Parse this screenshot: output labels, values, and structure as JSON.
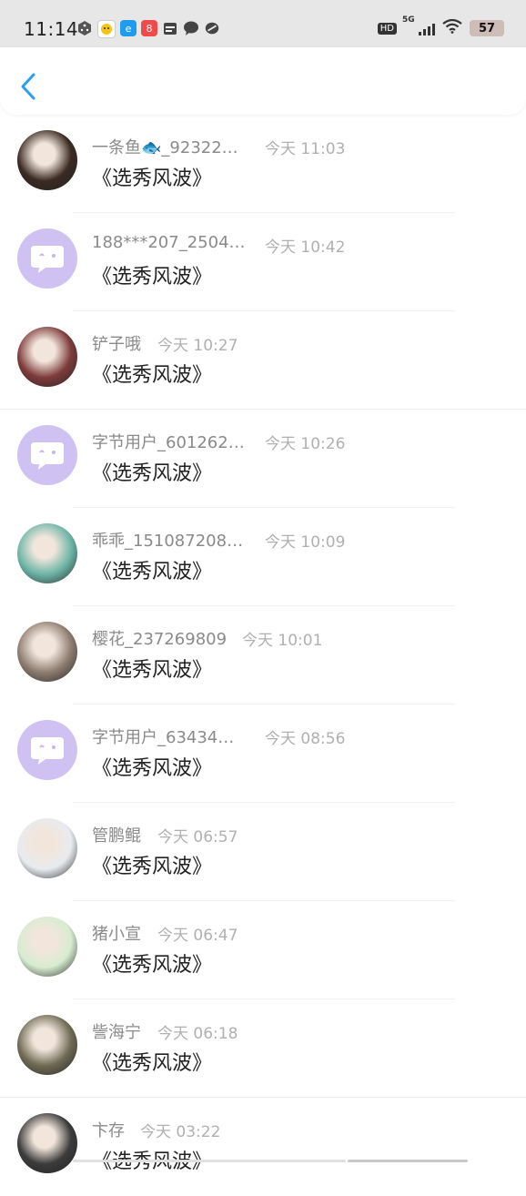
{
  "status_bar": {
    "time": "11:14",
    "network": "5G",
    "hd_label": "HD",
    "battery": "57",
    "notification_icons": [
      "dice-icon",
      "smiley-app-icon",
      "e-app-icon",
      "red-app-icon",
      "calendar-icon",
      "chat-bubble-icon",
      "link-icon"
    ]
  },
  "header": {
    "back_icon": "chevron-left-icon",
    "accent": "#2a9df4"
  },
  "messages": [
    {
      "name": "一条鱼🐟_92322…",
      "time": "今天 11:03",
      "content": "《选秀风波》",
      "avatar": "photo",
      "avatar_color": "#3a2a22"
    },
    {
      "name": "188***207_2504…",
      "time": "今天 10:42",
      "content": "《选秀风波》",
      "avatar": "placeholder",
      "avatar_color": "#cfc2f3"
    },
    {
      "name": "铲子哦",
      "time": "今天 10:27",
      "content": "《选秀风波》",
      "avatar": "photo",
      "avatar_color": "#7d3b3b"
    },
    {
      "name": "字节用户_601262…",
      "time": "今天 10:26",
      "content": "《选秀风波》",
      "avatar": "placeholder",
      "avatar_color": "#cfc2f3"
    },
    {
      "name": "乖乖_151087208…",
      "time": "今天 10:09",
      "content": "《选秀风波》",
      "avatar": "photo",
      "avatar_color": "#6fb5a8"
    },
    {
      "name": "樱花_237269809",
      "time": "今天 10:01",
      "content": "《选秀风波》",
      "avatar": "photo",
      "avatar_color": "#8d7c70"
    },
    {
      "name": "字节用户_63434…",
      "time": "今天 08:56",
      "content": "《选秀风波》",
      "avatar": "placeholder",
      "avatar_color": "#cfc2f3"
    },
    {
      "name": "管鹏鲲",
      "time": "今天 06:57",
      "content": "《选秀风波》",
      "avatar": "photo",
      "avatar_color": "#e8ebef"
    },
    {
      "name": "猪小宣",
      "time": "今天 06:47",
      "content": "《选秀风波》",
      "avatar": "photo",
      "avatar_color": "#d7ecd0"
    },
    {
      "name": "訾海宁",
      "time": "今天 06:18",
      "content": "《选秀风波》",
      "avatar": "photo",
      "avatar_color": "#6e6a54"
    },
    {
      "name": "卞存",
      "time": "今天 03:22",
      "content": "《选秀风波》",
      "avatar": "photo",
      "avatar_color": "#3b3b3b"
    }
  ]
}
